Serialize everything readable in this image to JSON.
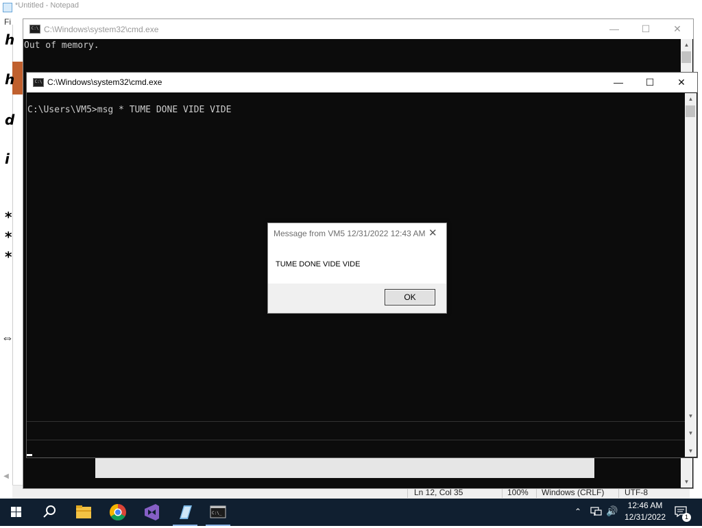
{
  "notepad": {
    "title": "*Untitled - Notepad",
    "menu_first": "Fi",
    "left_chars": [
      "h",
      "h",
      "d",
      "i",
      "*",
      "*",
      "*"
    ],
    "statusbar": {
      "position": "Ln 12, Col 35",
      "zoom": "100%",
      "line_ending": "Windows (CRLF)",
      "encoding": "UTF-8"
    }
  },
  "cmd_back": {
    "title": "C:\\Windows\\system32\\cmd.exe",
    "output": "Out of memory."
  },
  "cmd_front": {
    "title": "C:\\Windows\\system32\\cmd.exe",
    "prompt_line": "C:\\Users\\VM5>msg * TUME DONE VIDE VIDE"
  },
  "message_box": {
    "title": "Message from VM5 12/31/2022 12:43 AM",
    "message": "TUME DONE VIDE VIDE",
    "ok_label": "OK"
  },
  "taskbar": {
    "apps": [
      "start-icon",
      "search-icon",
      "file-explorer-icon",
      "chrome-icon",
      "visual-studio-icon",
      "notepad-icon",
      "cmd-icon"
    ],
    "clock_time": "12:46 AM",
    "clock_date": "12/31/2022",
    "notification_count": "1"
  },
  "colors": {
    "console_bg": "#0c0c0c",
    "console_text": "#cccccc",
    "taskbar_bg": "#101f30",
    "accent_orange": "#c0602e"
  }
}
